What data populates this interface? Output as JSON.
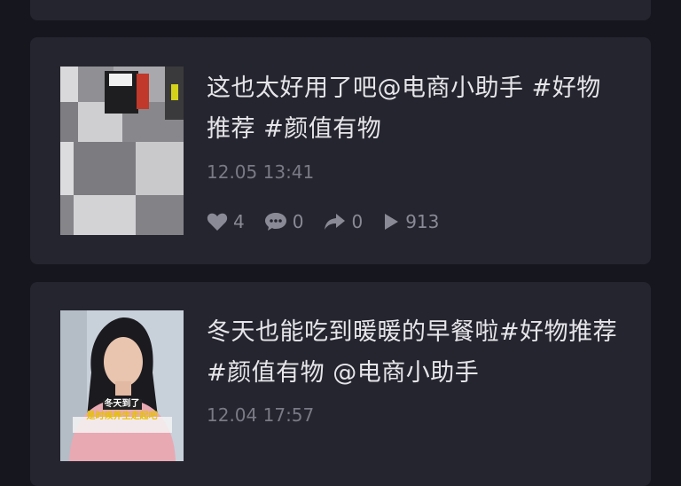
{
  "posts": [
    {
      "title": "这也太好用了吧@电商小助手 #好物推荐 #颜值有物",
      "time": "12.05 13:41",
      "likes": "4",
      "comments": "0",
      "shares": "0",
      "views": "913"
    },
    {
      "title": "冬天也能吃到暖暖的早餐啦#好物推荐 #颜值有物 @电商小助手",
      "time": "12.04 17:57",
      "thumb_caption_1": "冬天到了",
      "thumb_caption_2": "是时候养生走起吧"
    }
  ],
  "colors": {
    "background": "#16161e",
    "card": "#25252f",
    "title_text": "#e6e6ea",
    "meta_text": "#7a7a86"
  }
}
